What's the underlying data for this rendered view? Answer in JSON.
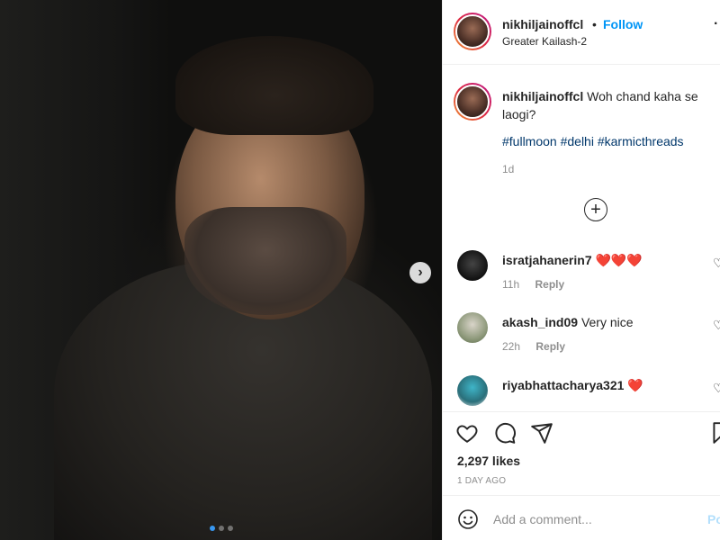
{
  "post": {
    "username": "nikhiljainoffcl",
    "follow_label": "Follow",
    "separator": "•",
    "location": "Greater Kailash-2",
    "more_glyph": "·"
  },
  "caption": {
    "username": "nikhiljainoffcl",
    "text": "Woh chand kaha se laogi?",
    "hashtags": "#fullmoon #delhi #karmicthreads",
    "age": "1d"
  },
  "load_more_glyph": "+",
  "comments": [
    {
      "username": "isratjahanerin7",
      "text": "❤️❤️❤️",
      "age": "11h",
      "reply_label": "Reply"
    },
    {
      "username": "akash_ind09",
      "text": "Very nice",
      "age": "22h",
      "reply_label": "Reply"
    },
    {
      "username": "riyabhattacharya321",
      "text": "❤️",
      "age": "",
      "reply_label": ""
    }
  ],
  "likes": "2,297 likes",
  "posted_when": "1 DAY AGO",
  "add_comment": {
    "placeholder": "Add a comment...",
    "post_label": "Po"
  },
  "carousel": {
    "total": 3,
    "active": 1
  },
  "colors": {
    "link": "#0095f6",
    "hashtag": "#00376b",
    "heart": "#ed4956",
    "muted": "#8e8e8e"
  },
  "icons": [
    "like-icon",
    "comment-icon",
    "share-icon",
    "save-icon",
    "emoji-icon",
    "next-arrow-icon",
    "add-circle-icon"
  ]
}
